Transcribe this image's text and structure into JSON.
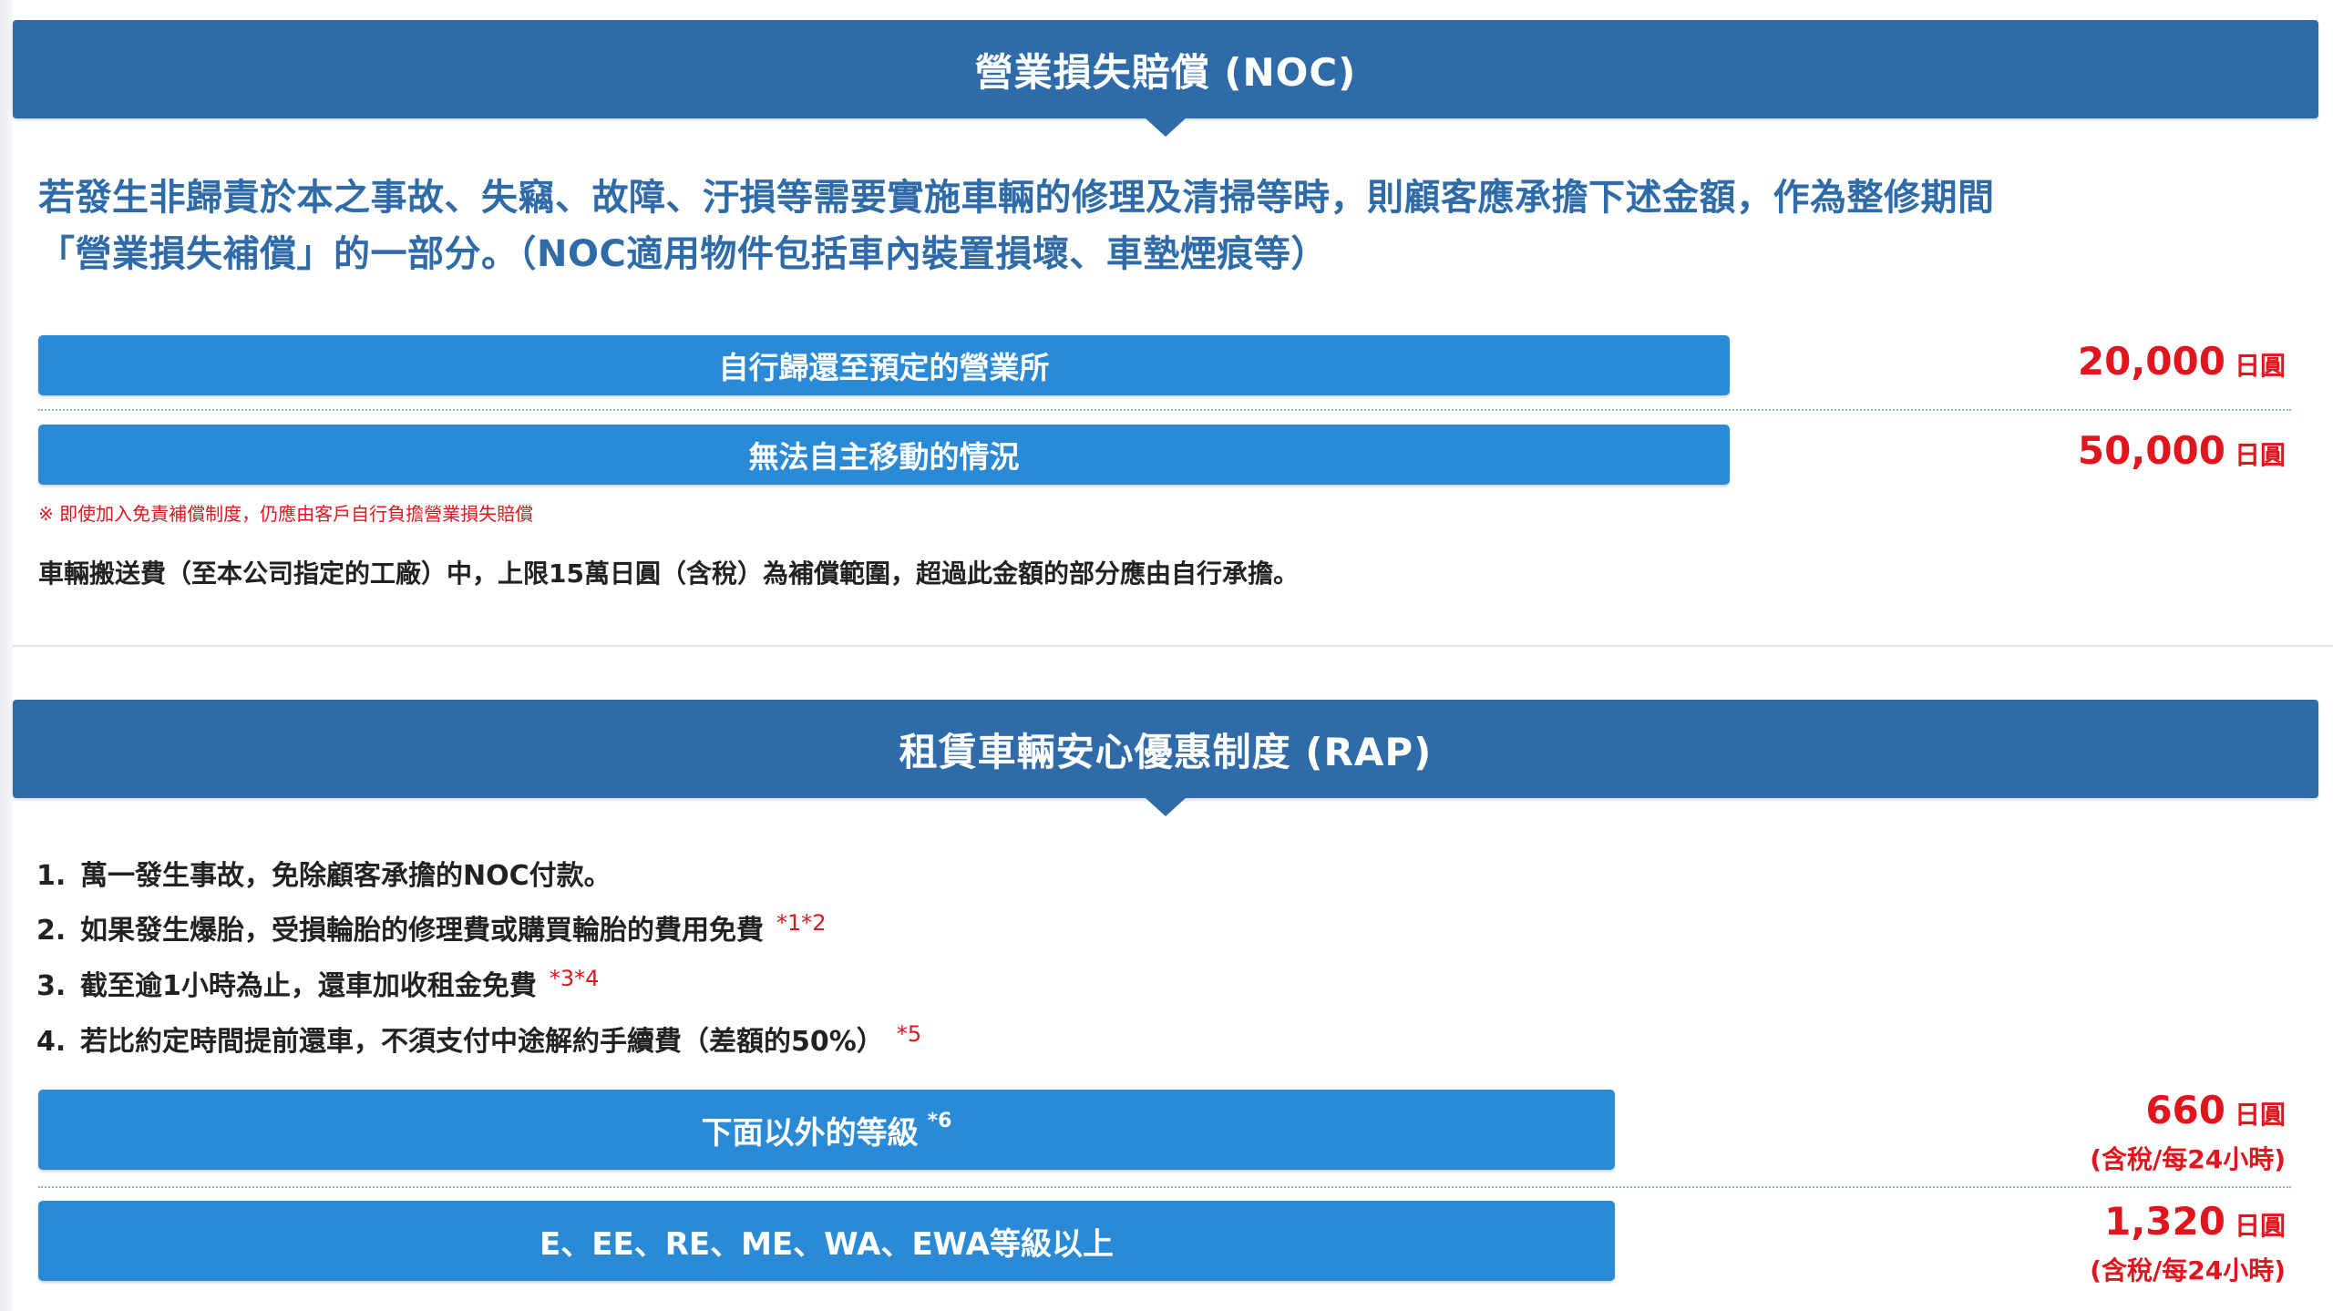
{
  "noc": {
    "title": "營業損失賠償 (NOC)",
    "lead_line1": "若發生非歸責於本之事故、失竊、故障、汙損等需要實施車輛的修理及清掃等時，則顧客應承擔下述金額，作為整修期間",
    "lead_line2": "「營業損失補償」的一部分。（NOC適用物件包括車內裝置損壞、車墊煙痕等）",
    "rows": [
      {
        "label": "自行歸還至預定的營業所",
        "amount": "20,000",
        "unit": "日圓"
      },
      {
        "label": "無法自主移動的情況",
        "amount": "50,000",
        "unit": "日圓"
      }
    ],
    "note": "※ 即使加入免責補償制度，仍應由客戶自行負擔營業損失賠償",
    "transport_text": "車輛搬送費（至本公司指定的工廠）中，上限15萬日圓（含稅）為補償範圍，超過此金額的部分應由自行承擔。"
  },
  "rap": {
    "title": "租賃車輛安心優惠制度 (RAP)",
    "items": [
      {
        "num": "1.",
        "text": "萬一發生事故，免除顧客承擔的NOC付款。",
        "mark": ""
      },
      {
        "num": "2.",
        "text": "如果發生爆胎，受損輪胎的修理費或購買輪胎的費用免費",
        "mark": "*1*2"
      },
      {
        "num": "3.",
        "text": "截至逾1小時為止，還車加收租金免費",
        "mark": "*3*4"
      },
      {
        "num": "4.",
        "text": "若比約定時間提前還車，不須支付中途解約手續費（差額的50%）",
        "mark": "*5"
      }
    ],
    "tiers": [
      {
        "label": "下面以外的等級",
        "mark": "*6",
        "amount": "660",
        "unit": "日圓",
        "note": "(含稅/每24小時)"
      },
      {
        "label": "E、EE、RE、ME、WA、EWA等級以上",
        "mark": "",
        "amount": "1,320",
        "unit": "日圓",
        "note": "(含稅/每24小時)"
      }
    ]
  },
  "colors": {
    "header_bg": "#2f6ba8",
    "button_bg": "#2b8ad6",
    "price_red": "#e0151d",
    "lead_blue": "#2f6ba8"
  }
}
